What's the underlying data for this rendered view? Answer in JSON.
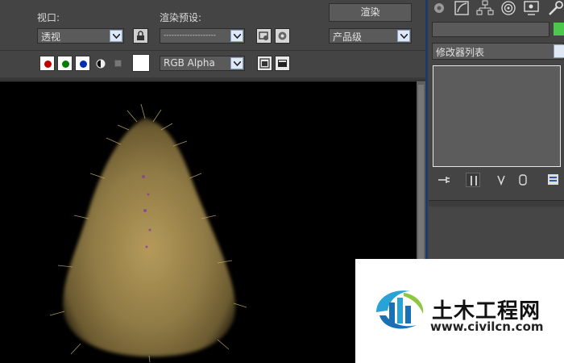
{
  "toolbar": {
    "viewport_label": "视口:",
    "viewport_value": "透视",
    "preset_label": "渲染预设:",
    "preset_value": "--------------------",
    "render_button": "渲染",
    "quality_value": "产品级"
  },
  "display": {
    "channel_value": "RGB Alpha",
    "colors": {
      "red": "#c00000",
      "green": "#008000",
      "blue": "#0030b0",
      "swatch": "#ffffff"
    }
  },
  "command_panel": {
    "modifier_list": "修改器列表",
    "object_color": "#4cc84c",
    "tabs": [
      "create-icon",
      "modify-icon",
      "hierarchy-icon",
      "motion-icon",
      "display-icon",
      "utilities-icon"
    ]
  },
  "watermark": {
    "name": "土木工程网",
    "url": "www.civilcn.com"
  }
}
